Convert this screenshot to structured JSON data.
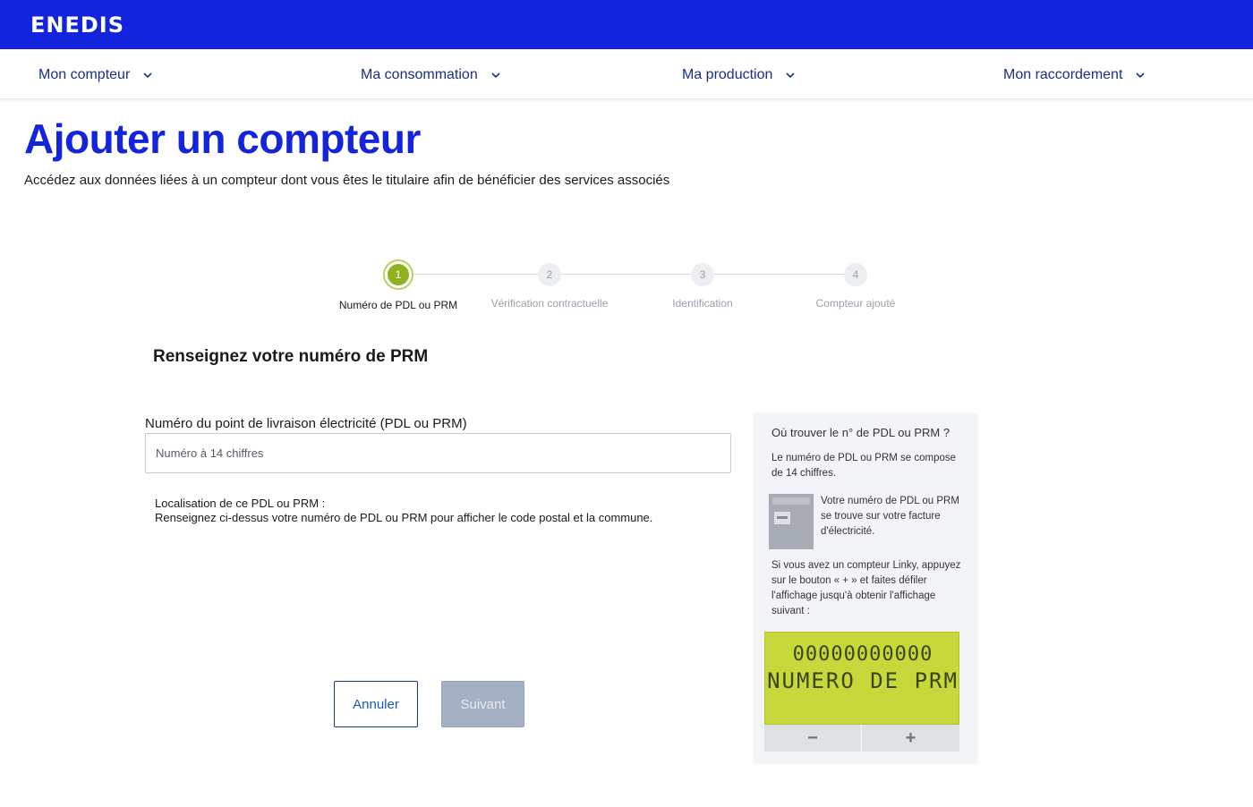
{
  "brand": {
    "logo": "ENEDIS",
    "color": "#1423dc"
  },
  "nav": {
    "items": [
      {
        "label": "Mon compteur"
      },
      {
        "label": "Ma consommation"
      },
      {
        "label": "Ma production"
      },
      {
        "label": "Mon raccordement"
      }
    ]
  },
  "page": {
    "title": "Ajouter un compteur",
    "subtitle": "Accédez aux données liées à un compteur dont vous êtes le titulaire afin de bénéficier des services associés"
  },
  "stepper": {
    "active_index": 0,
    "steps": [
      {
        "number": "1",
        "label": "Numéro de PDL ou PRM"
      },
      {
        "number": "2",
        "label": "Vérification contractuelle"
      },
      {
        "number": "3",
        "label": "Identification"
      },
      {
        "number": "4",
        "label": "Compteur ajouté"
      }
    ]
  },
  "form": {
    "title": "Renseignez votre numéro de PRM",
    "field_label": "Numéro du point de livraison électricité (PDL ou PRM)",
    "field_value": "",
    "field_placeholder": "Numéro à 14 chiffres",
    "location_title": "Localisation de ce PDL ou PRM :",
    "location_text": "Renseignez ci-dessus votre numéro de PDL ou PRM pour afficher le code postal et la commune.",
    "cancel_label": "Annuler",
    "next_label": "Suivant"
  },
  "help": {
    "title": "Où trouver le n° de PDL ou PRM ?",
    "p1": "Le numéro de PDL ou PRM se compose de 14 chiffres.",
    "p2": "Votre numéro de PDL ou PRM se trouve sur votre facture d'électricité.",
    "p3": "Si vous avez un compteur Linky, appuyez sur le bouton « + » et faites défiler l'affichage jusqu'à obtenir l'affichage suivant :",
    "lcd_digits": "00000000000",
    "lcd_text": "NUMERO DE PRM",
    "minus_label": "−",
    "plus_label": "+",
    "lcd_color": "#c7d93a"
  }
}
